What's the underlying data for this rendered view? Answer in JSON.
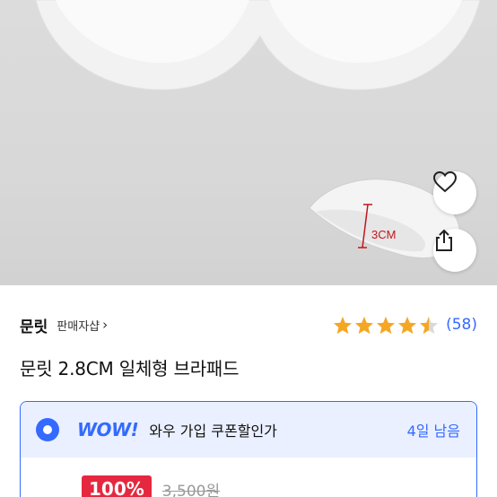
{
  "seller": {
    "brand": "문릿",
    "store_link": "판매자샵",
    "review_count": "(58)"
  },
  "rating": {
    "value": 4.5,
    "max": 5
  },
  "product": {
    "title": "문릿 2.8CM 일체형 브라패드",
    "image_annotation": "3CM"
  },
  "wow_coupon": {
    "logo": "WOW!",
    "label": "와우 가입 쿠폰할인가",
    "days_left": "4일 남음"
  },
  "price": {
    "discount": "100%",
    "original": "3,500원"
  },
  "colors": {
    "accent_blue": "#346aff",
    "star": "#f5a623",
    "discount_red": "#e5283f",
    "annotation_red": "#c0161b"
  },
  "icons": [
    "heart-icon",
    "share-icon",
    "chevron-right-icon",
    "star-icon",
    "radio-selected-icon"
  ]
}
